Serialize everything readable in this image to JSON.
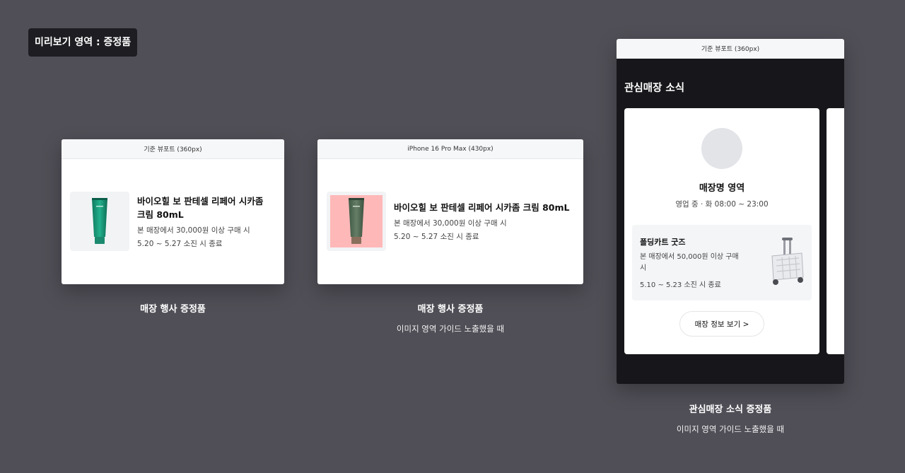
{
  "preview_tag": "미리보기 영역 : 증정품",
  "frames": [
    {
      "header": "기준 뷰포트 (360px)",
      "gift": {
        "name": "바이오힐 보 판테셀 리페어 시카좀 크림 80mL",
        "condition": "본 매장에서 30,000원 이상 구매 시",
        "date": "5.20 ~ 5.27 소진 시 종료",
        "image": "green-cream-tube"
      },
      "caption_title": "매장 행사 증정품"
    },
    {
      "header": "iPhone 16 Pro Max (430px)",
      "gift": {
        "name": "바이오힐 보 판테셀 리페어 시카좀 크림 80mL",
        "condition": "본 매장에서 30,000원 이상 구매 시",
        "date": "5.20 ~ 5.27 소진 시 종료",
        "image": "green-cream-tube-guide"
      },
      "caption_title": "매장 행사 증정품",
      "caption_sub": "이미지 영역 가이드 노출했을 때"
    },
    {
      "header": "기준 뷰포트 (360px)",
      "section_title": "관심매장 소식",
      "store": {
        "name": "매장명 영역",
        "hours": "영업 중 · 화 08:00 ~ 23:00",
        "promo": {
          "name": "폴딩카트 굿즈",
          "condition": "본 매장에서 50,000원 이상 구매 시",
          "date": "5.10 ~ 5.23 소진 시 종료",
          "image": "folding-cart"
        },
        "button_label": "매장 정보 보기 >"
      },
      "caption_title": "관심매장 소식 증정품",
      "caption_sub": "이미지 영역 가이드 노출했을 때"
    }
  ],
  "colors": {
    "background": "#504f57",
    "dark_panel": "#17171b",
    "guide_fill": "#ffb8b8",
    "tube_green": "#1a9a7a"
  }
}
